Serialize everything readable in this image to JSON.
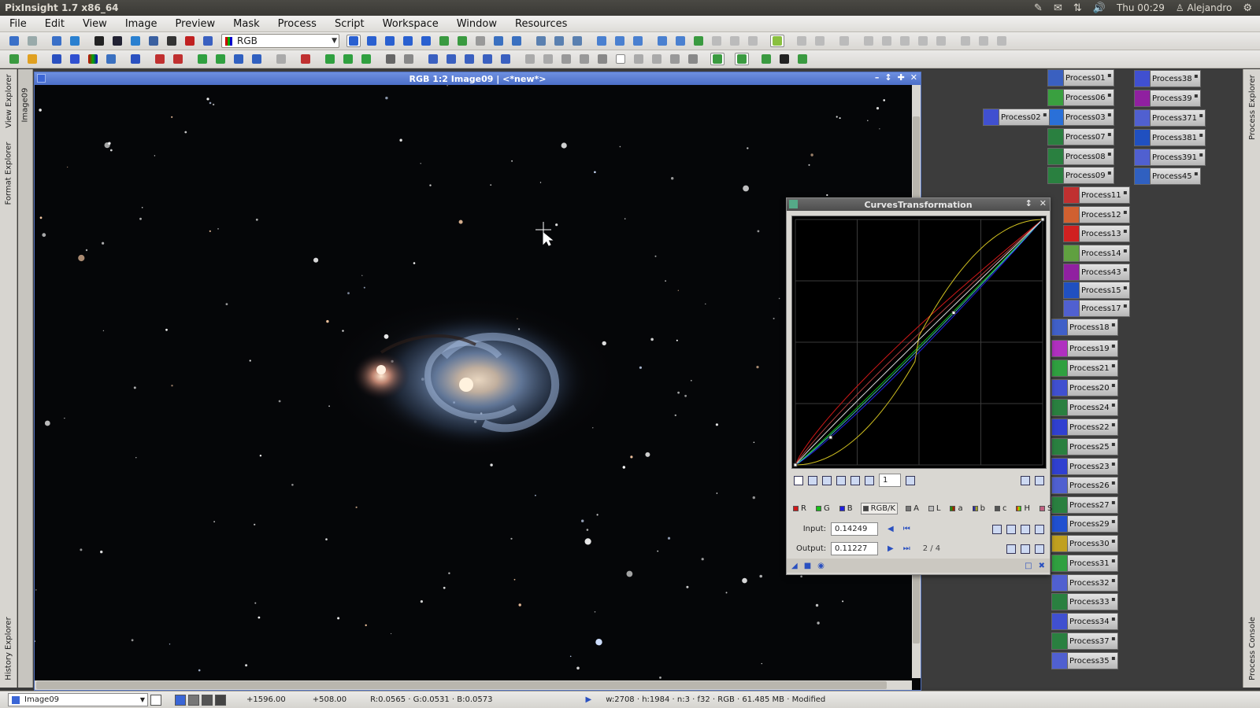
{
  "app": {
    "title": "PixInsight 1.7 x86_64"
  },
  "tray": {
    "clock": "Thu 00:29",
    "user": "Alejandro"
  },
  "menu": [
    "File",
    "Edit",
    "View",
    "Image",
    "Preview",
    "Mask",
    "Process",
    "Script",
    "Workspace",
    "Window",
    "Resources"
  ],
  "toolbar": {
    "view_select": "RGB"
  },
  "left_dock": {
    "view_explorer": "View Explorer",
    "format_explorer": "Format Explorer",
    "history_explorer": "History Explorer",
    "image_tab": "Image09"
  },
  "right_dock": {
    "process_explorer": "Process Explorer",
    "process_console": "Process Console"
  },
  "image_window": {
    "title": "RGB 1:2 Image09 | <*new*>"
  },
  "curves": {
    "title": "CurvesTransformation",
    "zoom": "1",
    "channels": [
      "R",
      "G",
      "B",
      "RGB/K",
      "A",
      "L",
      "a",
      "b",
      "c",
      "H",
      "S"
    ],
    "selected_channel": "RGB/K",
    "input_label": "Input:",
    "input_value": "0.14249",
    "output_label": "Output:",
    "output_value": "0.11227",
    "point_counter": "2 / 4",
    "colors": {
      "R": "#d01818",
      "G": "#18c018",
      "B": "#2020e0",
      "RGB/K": "#dddddd"
    }
  },
  "process_icons": [
    {
      "label": "Process01",
      "c": "#3a60c0"
    },
    {
      "label": "Process06",
      "c": "#3aa040"
    },
    {
      "label": "Process03",
      "c": "#2a70d8"
    },
    {
      "label": "Process07",
      "c": "#2a8040"
    },
    {
      "label": "Process08",
      "c": "#2a8040"
    },
    {
      "label": "Process09",
      "c": "#2a8040"
    },
    {
      "label": "Process11",
      "c": "#c03030"
    },
    {
      "label": "Process12",
      "c": "#d06030"
    },
    {
      "label": "Process13",
      "c": "#d02020"
    },
    {
      "label": "Process14",
      "c": "#60a040"
    },
    {
      "label": "Process43",
      "c": "#9020a0"
    },
    {
      "label": "Process15",
      "c": "#2050c0"
    },
    {
      "label": "Process17",
      "c": "#5060d0"
    },
    {
      "label": "Process18",
      "c": "#4060c8"
    },
    {
      "label": "Process19",
      "c": "#b030c0"
    },
    {
      "label": "Process21",
      "c": "#30a040"
    },
    {
      "label": "Process20",
      "c": "#4050d0"
    },
    {
      "label": "Process24",
      "c": "#2a8040"
    },
    {
      "label": "Process22",
      "c": "#3040d0"
    },
    {
      "label": "Process25",
      "c": "#2a8040"
    },
    {
      "label": "Process23",
      "c": "#3040d0"
    },
    {
      "label": "Process26",
      "c": "#5060d0"
    },
    {
      "label": "Process27",
      "c": "#2a8040"
    },
    {
      "label": "Process29",
      "c": "#2050d0"
    },
    {
      "label": "Process30",
      "c": "#c0a020"
    },
    {
      "label": "Process31",
      "c": "#30a040"
    },
    {
      "label": "Process32",
      "c": "#5060d0"
    },
    {
      "label": "Process33",
      "c": "#2a8040"
    },
    {
      "label": "Process34",
      "c": "#4050d0"
    },
    {
      "label": "Process37",
      "c": "#2a8040"
    },
    {
      "label": "Process35",
      "c": "#5060d0"
    },
    {
      "label": "Process38",
      "c": "#4050d0"
    },
    {
      "label": "Process39",
      "c": "#9020a0"
    },
    {
      "label": "Process371",
      "c": "#5060d0"
    },
    {
      "label": "Process381",
      "c": "#2050c0"
    },
    {
      "label": "Process391",
      "c": "#5060d0"
    },
    {
      "label": "Process45",
      "c": "#3060c0"
    },
    {
      "label": "Process02",
      "c": "#4050d0"
    }
  ],
  "status": {
    "view": "Image09",
    "cursor_x": "+1596.00",
    "cursor_y": "+508.00",
    "rgb": "R:0.0565 · G:0.0531 · B:0.0573",
    "info": "w:2708 · h:1984 · n:3 · f32 · RGB · 61.485 MB · Modified"
  }
}
